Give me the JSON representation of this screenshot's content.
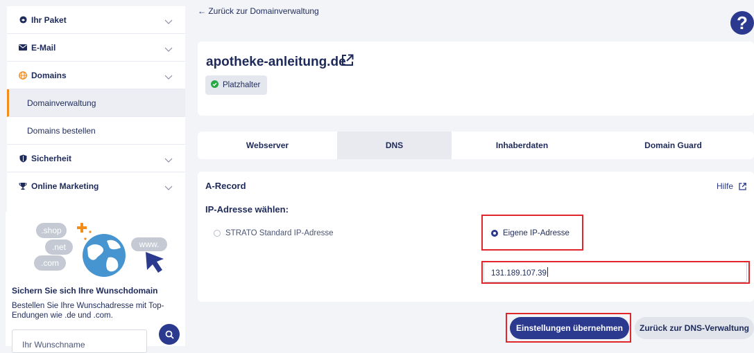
{
  "sidebar": {
    "items": [
      {
        "label": "Ihr Paket",
        "icon": "package-icon"
      },
      {
        "label": "E-Mail",
        "icon": "mail-icon"
      },
      {
        "label": "Domains",
        "icon": "globe-icon"
      },
      {
        "label": "Domainverwaltung",
        "active": true
      },
      {
        "label": "Domains bestellen"
      },
      {
        "label": "Sicherheit",
        "icon": "shield-icon"
      },
      {
        "label": "Online Marketing",
        "icon": "trophy-icon"
      }
    ]
  },
  "promo": {
    "tags": [
      ".shop",
      ".net",
      ".com",
      "www."
    ],
    "title": "Sichern Sie sich Ihre Wunschdomain",
    "text": "Bestellen Sie Ihre Wunschadresse mit Top-Endungen wie .de und .com.",
    "input_placeholder": "Ihr Wunschname"
  },
  "header": {
    "back_link": "← Zurück zur Domainverwaltung",
    "help_symbol": "?"
  },
  "domain": {
    "name": "apotheke-anleitung.de",
    "status_badge": "Platzhalter"
  },
  "tabs": [
    {
      "label": "Webserver",
      "active": false
    },
    {
      "label": "DNS",
      "active": true
    },
    {
      "label": "Inhaberdaten",
      "active": false
    },
    {
      "label": "Domain Guard",
      "active": false
    }
  ],
  "dns": {
    "record_title": "A-Record",
    "help_link": "Hilfe",
    "ip_label": "IP-Adresse wählen:",
    "option_standard": "STRATO Standard IP-Adresse",
    "option_custom": "Eigene IP-Adresse",
    "selected_option": "Eigene IP-Adresse",
    "ip_value": "131.189.107.39"
  },
  "actions": {
    "apply": "Einstellungen übernehmen",
    "back_dns": "Zurück zur DNS-Verwaltung"
  },
  "colors": {
    "accent": "#2b3a8f",
    "active_marker": "#f28c1a",
    "status_ok": "#27a844",
    "highlight": "#e0262b"
  }
}
